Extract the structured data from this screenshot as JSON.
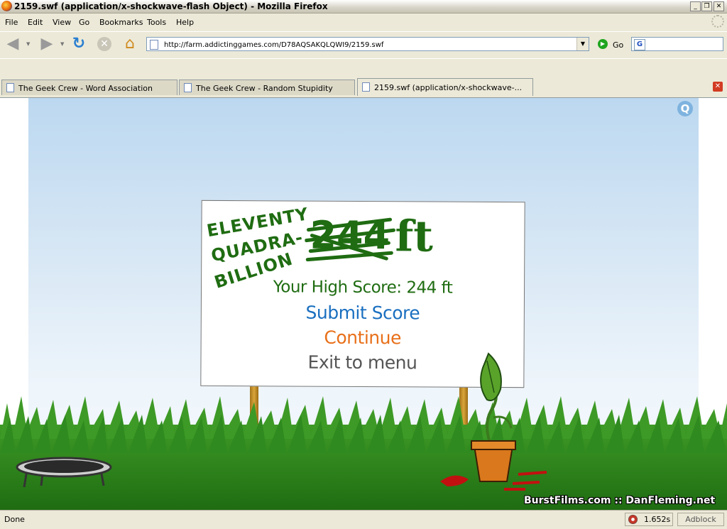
{
  "window": {
    "title": "2159.swf (application/x-shockwave-flash Object) - Mozilla Firefox",
    "minimize": "_",
    "maximize": "❐",
    "close": "✕"
  },
  "menu": [
    "File",
    "Edit",
    "View",
    "Go",
    "Bookmarks",
    "Tools",
    "Help"
  ],
  "nav": {
    "url": "http://farm.addictinggames.com/D78AQSAKQLQWI9/2159.swf",
    "go_label": "Go",
    "search_engine_glyph": "G"
  },
  "tabs": [
    {
      "label": "The Geek Crew - Word Association",
      "active": false
    },
    {
      "label": "The Geek Crew - Random Stupidity",
      "active": false
    },
    {
      "label": "2159.swf (application/x-shockwave-...",
      "active": true
    }
  ],
  "game": {
    "corner_logo": "Q",
    "score_words": [
      "ELEVENTY",
      "QUADRA-",
      "BILLION"
    ],
    "score_struck": "244",
    "score_unit": "ft",
    "high_score_text": "Your High Score: 244 ft",
    "options": [
      {
        "label": "Submit Score",
        "color": "#1a6fc0"
      },
      {
        "label": "Continue",
        "color": "#e8701a"
      },
      {
        "label": "Exit to menu",
        "color": "#555555"
      }
    ],
    "credit": "BurstFilms.com :: DanFleming.net",
    "grass_color": "#2f8a1f",
    "sky_color": "#bcd8f0"
  },
  "status": {
    "text": "Done",
    "load_time": "1.652s",
    "adblock": "Adblock"
  }
}
